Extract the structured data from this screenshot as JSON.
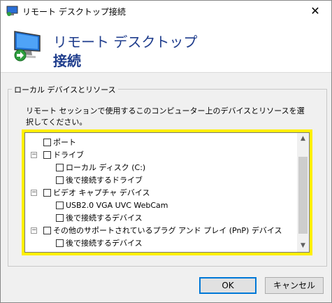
{
  "window": {
    "title": "リモート デスクトップ接続",
    "close_glyph": "✕"
  },
  "header": {
    "line1": "リモート デスクトップ",
    "line2": "接続"
  },
  "group": {
    "legend": "ローカル デバイスとリソース",
    "description": "リモート セッションで使用するこのコンピューター上のデバイスとリソースを選択してください。"
  },
  "tree": {
    "items": [
      {
        "label": "ポート",
        "expander": "",
        "checked": false
      },
      {
        "label": "ドライブ",
        "expander": "−",
        "checked": false
      },
      {
        "label": "ローカル ディスク (C:)",
        "expander": "",
        "checked": false
      },
      {
        "label": "後で接続するドライブ",
        "expander": "",
        "checked": false
      },
      {
        "label": "ビデオ キャプチャ デバイス",
        "expander": "−",
        "checked": false
      },
      {
        "label": "USB2.0 VGA UVC WebCam",
        "expander": "",
        "checked": false
      },
      {
        "label": "後で接続するデバイス",
        "expander": "",
        "checked": false
      },
      {
        "label": "その他のサポートされているプラグ アンド プレイ (PnP) デバイス",
        "expander": "−",
        "checked": false
      },
      {
        "label": "後で接続するデバイス",
        "expander": "",
        "checked": false
      }
    ]
  },
  "scrollbar": {
    "up_glyph": "▲",
    "down_glyph": "▼"
  },
  "buttons": {
    "ok": "OK",
    "cancel": "キャンセル"
  },
  "colors": {
    "accent": "#0078d7",
    "highlight": "#ffef00",
    "header_text": "#1e3c8c"
  },
  "icons": [
    "remote-desktop-app-icon",
    "remote-desktop-monitor-icon",
    "close-icon",
    "scroll-up-icon",
    "scroll-down-icon"
  ]
}
